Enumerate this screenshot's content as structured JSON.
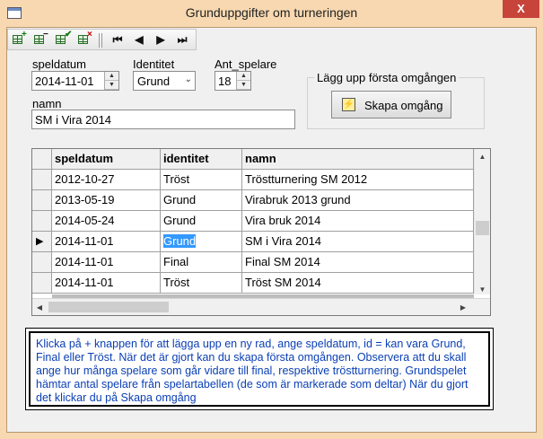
{
  "window": {
    "title": "Grunduppgifter om turneringen",
    "close_glyph": "X"
  },
  "toolbar": {
    "add_badge": "+",
    "delete_badge": "−",
    "save_badge": "✔",
    "cancel_badge": "×",
    "first_glyph": "⏮",
    "prev_glyph": "◀",
    "next_glyph": "▶",
    "last_glyph": "⏭"
  },
  "form": {
    "speldatum_label": "speldatum",
    "speldatum_value": "2014-11-01",
    "identitet_label": "Identitet",
    "identitet_value": "Grund",
    "ant_spelare_label": "Ant_spelare",
    "ant_spelare_value": "18",
    "namn_label": "namn",
    "namn_value": "SM i Vira 2014",
    "group_label": "Lägg upp första omgången",
    "create_round_label": "Skapa omgång"
  },
  "grid": {
    "columns": [
      "speldatum",
      "identitet",
      "namn"
    ],
    "rows": [
      [
        "2012-10-27",
        "Tröst",
        "Tröstturnering SM 2012"
      ],
      [
        "2013-05-19",
        "Grund",
        "Virabruk 2013 grund"
      ],
      [
        "2014-05-24",
        "Grund",
        "Vira bruk 2014"
      ],
      [
        "2014-11-01",
        "Grund",
        "SM i Vira 2014"
      ],
      [
        "2014-11-01",
        "Final",
        "Final SM 2014"
      ],
      [
        "2014-11-01",
        "Tröst",
        "Tröst SM 2014"
      ]
    ],
    "current_row_pointer": "▶"
  },
  "help": {
    "text": "Klicka på + knappen för att lägga upp en ny rad, ange speldatum, id = kan vara Grund, Final eller Tröst.  När det är gjort kan du skapa första omgången. Observera att du skall ange hur många spelare som går vidare till final, respektive tröstturnering. Grundspelet hämtar antal spelare från spelartabellen (de som är markerade som deltar)   När du gjort det klickar du på Skapa omgång"
  },
  "colors": {
    "window_frame": "#f7d8b0",
    "close_button": "#c7443b",
    "selection": "#3399ff",
    "help_text": "#0a3fb5"
  }
}
